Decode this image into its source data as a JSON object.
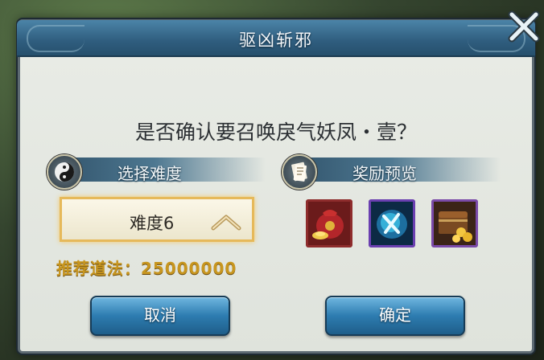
{
  "dialog": {
    "title": "驱凶斩邪",
    "question": "是否确认要召唤戾气妖凤・壹？"
  },
  "difficulty": {
    "header": "选择难度",
    "selected_value": "难度6",
    "recommend": "推荐道法：25000000"
  },
  "rewards": {
    "header": "奖励预览",
    "items": [
      {
        "icon": "treasure-bag-icon"
      },
      {
        "icon": "skill-crystal-icon"
      },
      {
        "icon": "gold-chest-icon"
      }
    ]
  },
  "buttons": {
    "cancel": "取消",
    "confirm": "确定"
  },
  "colors": {
    "title_bar": "#2f5d7e",
    "button": "#2d7cb0",
    "gold_text": "#c8961f",
    "selection_border": "#e6b95a",
    "reward_frame": "#7a4aa8"
  }
}
